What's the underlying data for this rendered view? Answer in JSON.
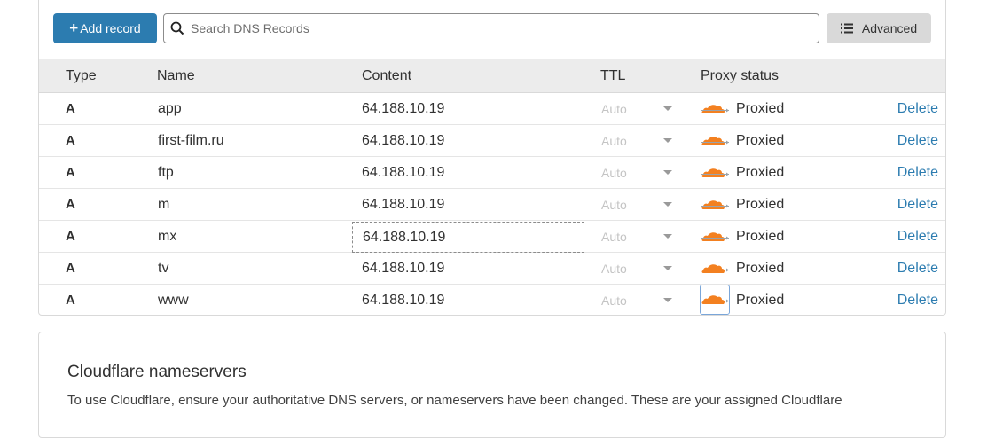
{
  "toolbar": {
    "add_label": "Add record",
    "add_plus": "+",
    "search_placeholder": "Search DNS Records",
    "advanced_label": "Advanced"
  },
  "table": {
    "headers": {
      "type": "Type",
      "name": "Name",
      "content": "Content",
      "ttl": "TTL",
      "proxy": "Proxy status"
    },
    "rows": [
      {
        "type": "A",
        "name": "app",
        "content": "64.188.10.19",
        "ttl": "Auto",
        "proxy": "Proxied",
        "action": "Delete"
      },
      {
        "type": "A",
        "name": "first-film.ru",
        "content": "64.188.10.19",
        "ttl": "Auto",
        "proxy": "Proxied",
        "action": "Delete"
      },
      {
        "type": "A",
        "name": "ftp",
        "content": "64.188.10.19",
        "ttl": "Auto",
        "proxy": "Proxied",
        "action": "Delete"
      },
      {
        "type": "A",
        "name": "m",
        "content": "64.188.10.19",
        "ttl": "Auto",
        "proxy": "Proxied",
        "action": "Delete"
      },
      {
        "type": "A",
        "name": "mx",
        "content": "64.188.10.19",
        "ttl": "Auto",
        "proxy": "Proxied",
        "action": "Delete"
      },
      {
        "type": "A",
        "name": "tv",
        "content": "64.188.10.19",
        "ttl": "Auto",
        "proxy": "Proxied",
        "action": "Delete"
      },
      {
        "type": "A",
        "name": "www",
        "content": "64.188.10.19",
        "ttl": "Auto",
        "proxy": "Proxied",
        "action": "Delete"
      }
    ]
  },
  "nameservers": {
    "title": "Cloudflare nameservers",
    "description": "To use Cloudflare, ensure your authoritative DNS servers, or nameservers have been changed. These are your assigned Cloudflare"
  },
  "colors": {
    "accent": "#2c7cb0",
    "cloud": "#f38020"
  },
  "icons": {
    "search": "search-icon",
    "advanced": "list-icon",
    "proxy": "cloud-icon"
  }
}
